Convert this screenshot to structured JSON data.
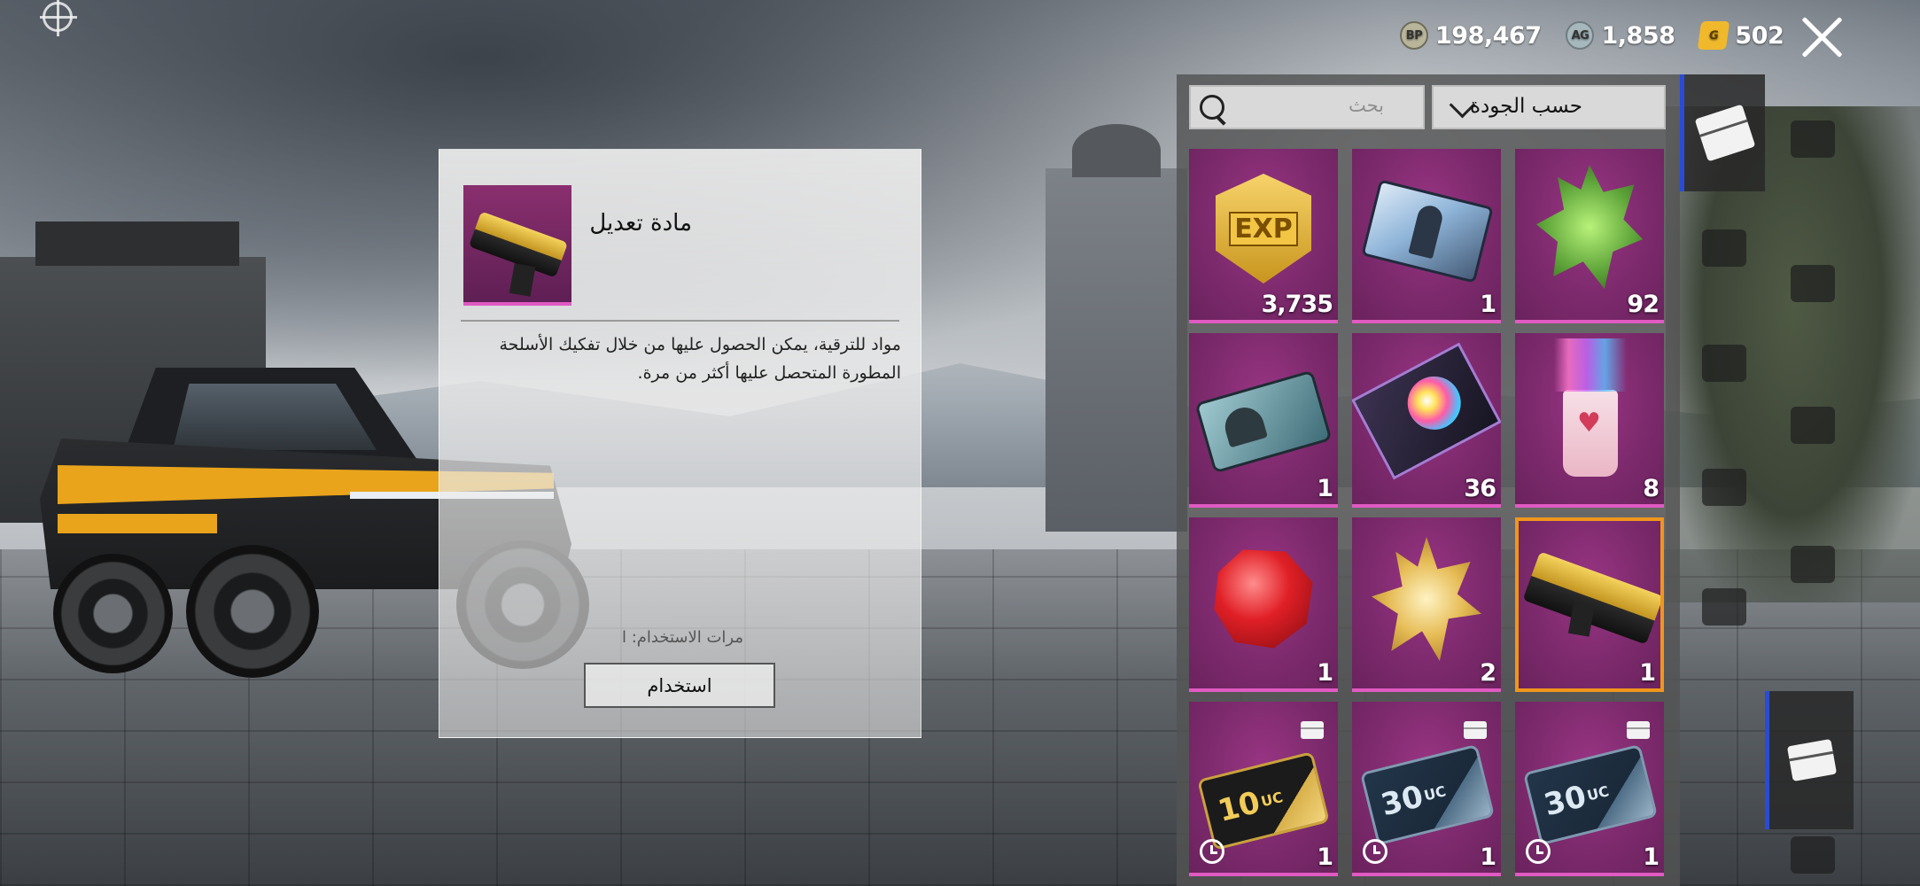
{
  "currencies": [
    {
      "icon": "bp-coin-icon",
      "icon_text": "BP",
      "value": "198,467"
    },
    {
      "icon": "silver-fragment-icon",
      "icon_text": "AG",
      "value": "1,858"
    },
    {
      "icon": "gold-g-coin-icon",
      "icon_text": "G",
      "value": "502"
    }
  ],
  "detail": {
    "title": "مادة تعديل",
    "description": "مواد للترقية، يمكن الحصول عليها من خلال تفكيك الأسلحة المطورة المتحصل عليها أكثر من مرة.",
    "uses_label": "مرات الاستخدام: ا",
    "use_button": "استخدام"
  },
  "inventory": {
    "search_placeholder": "بحث",
    "sort_label": "حسب الجودة",
    "items": [
      {
        "name": "exp-card",
        "qty": "3,735"
      },
      {
        "name": "id-card",
        "qty": "1"
      },
      {
        "name": "green-crystal",
        "qty": "92"
      },
      {
        "name": "helmet-ticket",
        "qty": "1"
      },
      {
        "name": "color-palette-box",
        "qty": "36"
      },
      {
        "name": "heart-cup",
        "qty": "8"
      },
      {
        "name": "red-gem",
        "qty": "1"
      },
      {
        "name": "gold-star-crystal",
        "qty": "2"
      },
      {
        "name": "upgrade-material",
        "qty": "1"
      },
      {
        "name": "uc-voucher-10",
        "qty": "1",
        "label": "10",
        "unit": "UC"
      },
      {
        "name": "uc-voucher-30",
        "qty": "1",
        "label": "30",
        "unit": "UC"
      },
      {
        "name": "uc-voucher-30",
        "qty": "1",
        "label": "30",
        "unit": "UC"
      }
    ]
  },
  "colors": {
    "tile_purple": "#7d2a6d",
    "tile_accent": "#e05ac2",
    "selected_border": "#f0961c",
    "active_tab": "#2a4bd6"
  }
}
